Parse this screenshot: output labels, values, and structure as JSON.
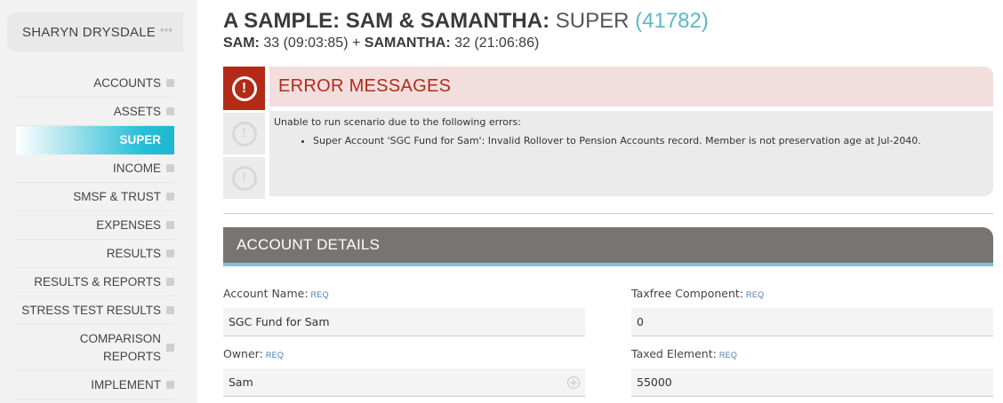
{
  "user": {
    "name": "SHARYN DRYSDALE",
    "stars": "***"
  },
  "nav": {
    "items": [
      {
        "label": "ACCOUNTS"
      },
      {
        "label": "ASSETS"
      },
      {
        "label": "SUPER"
      },
      {
        "label": "INCOME"
      },
      {
        "label": "SMSF & TRUST"
      },
      {
        "label": "EXPENSES"
      },
      {
        "label": "RESULTS"
      },
      {
        "label": "RESULTS & REPORTS"
      },
      {
        "label": "STRESS TEST RESULTS"
      },
      {
        "label_line1": "COMPARISON",
        "label_line2": "REPORTS"
      },
      {
        "label": "IMPLEMENT"
      }
    ],
    "active": "SUPER"
  },
  "header": {
    "title_bold": "A SAMPLE: SAM & SAMANTHA:",
    "title_light": "SUPER",
    "title_id": "(41782)",
    "sub_name1": "SAM:",
    "sub_val1": "33 (09:03:85)",
    "sub_plus": "+",
    "sub_name2": "SAMANTHA:",
    "sub_val2": "32 (21:06:86)"
  },
  "errors": {
    "title": "ERROR MESSAGES",
    "intro": "Unable to run scenario due to the following errors:",
    "items": [
      "Super Account 'SGC Fund for Sam': Invalid Rollover to Pension Accounts record. Member is not preservation age at Jul-2040."
    ],
    "icon_glyph": "!"
  },
  "account_details": {
    "title": "ACCOUNT DETAILS",
    "req": "REQ",
    "fields": {
      "account_name": {
        "label": "Account Name:",
        "value": "SGC Fund for Sam"
      },
      "owner": {
        "label": "Owner:",
        "value": "Sam"
      },
      "taxfree": {
        "label": "Taxfree Component:",
        "value": "0"
      },
      "taxed": {
        "label": "Taxed Element:",
        "value": "55000"
      }
    },
    "plus_glyph": "+"
  }
}
